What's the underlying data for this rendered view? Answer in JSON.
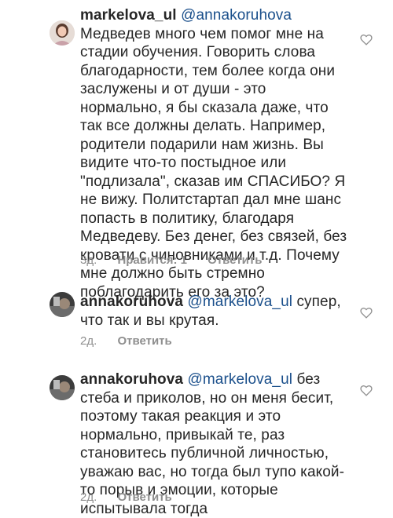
{
  "comments": [
    {
      "username": "markelova_ul",
      "mention": "@annakoruhova",
      "text": "Медведев много чем помог мне на стадии обучения. Говорить слова благодарности, тем более когда они заслужены и от души - это нормально, я бы сказала даже, что так все должны делать. Например, родители подарили нам жизнь. Вы видите что-то постыдное или \"подлизала\", сказав им СПАСИБО? Я не вижу. Политстартап дал мне шанс попасть в политику, благодаря Медведеву. Без денег, без связей, без кровати с чиновниками и т.д. Почему мне должно быть стремно поблагодарить его за это?",
      "time": "3д.",
      "likes": "Нравится: 1",
      "reply": "Ответить"
    },
    {
      "username": "annakoruhova",
      "mention": "@markelova_ul",
      "text": "супер, что так и вы крутая.",
      "time": "2д.",
      "reply": "Ответить"
    },
    {
      "username": "annakoruhova",
      "mention": "@markelova_ul",
      "text": "без стеба и приколов, но он меня бесит, поэтому такая реакция и это нормально, привыкай те, раз становитесь публичной личностью, уважаю вас, но тогда был тупо какой-то порыв и эмоции, которые испытывала тогда",
      "time": "2д.",
      "reply": "Ответить"
    }
  ],
  "icons": {
    "like": "heart-outline-icon",
    "avatar": "user-avatar"
  },
  "colors": {
    "mention": "#1a4f8b",
    "meta": "#8e8e8e",
    "text": "#262626"
  }
}
